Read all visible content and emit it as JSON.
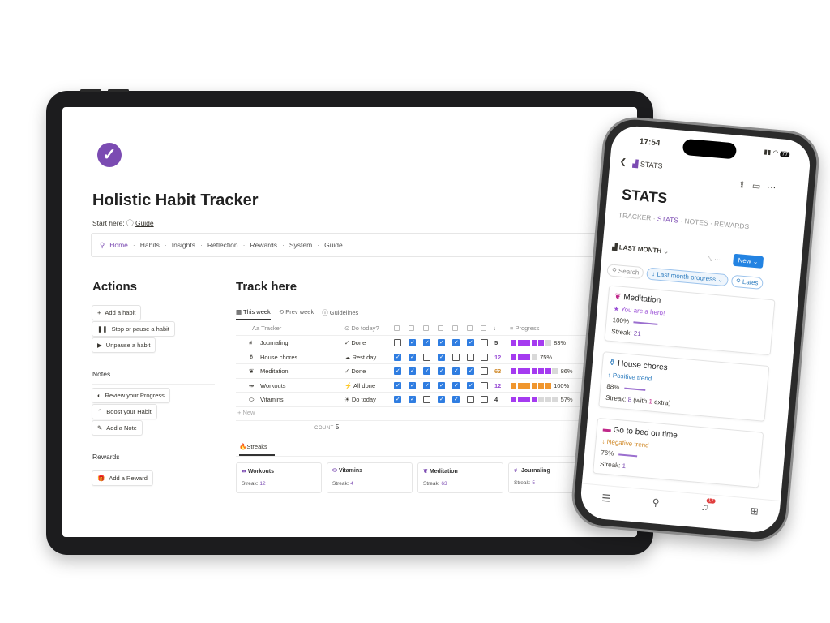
{
  "tablet": {
    "title": "Holistic Habit Tracker",
    "start_label": "Start here:",
    "start_link": "Guide",
    "nav": [
      "Home",
      "Habits",
      "Insights",
      "Reflection",
      "Rewards",
      "System",
      "Guide"
    ],
    "actions": {
      "heading": "Actions",
      "buttons": [
        "Add a habit",
        "Stop or pause a habit",
        "Unpause a habit"
      ]
    },
    "notes": {
      "heading": "Notes",
      "buttons": [
        "Review your Progress",
        "Boost your Habit",
        "Add a Note"
      ]
    },
    "rewards": {
      "heading": "Rewards",
      "buttons": [
        "Add a Reward"
      ]
    },
    "track": {
      "heading": "Track here",
      "tabs": [
        "This week",
        "Prev week",
        "Guidelines"
      ],
      "columns": {
        "tracker": "Tracker",
        "today": "Do today?",
        "progress": "Progress"
      },
      "rows": [
        {
          "name": "Journaling",
          "icon": "pen-lines-icon",
          "today": "Done",
          "today_icon": "✓",
          "checks": [
            0,
            1,
            1,
            1,
            1,
            1,
            0
          ],
          "streak": "5",
          "streak_color": "#333333",
          "filled": 5,
          "total": 6,
          "color": "#a53bf0",
          "pct": "83%"
        },
        {
          "name": "House chores",
          "icon": "broom-icon",
          "today": "Rest day",
          "today_icon": "☁",
          "checks": [
            1,
            1,
            0,
            1,
            0,
            0,
            0
          ],
          "streak": "12",
          "streak_color": "#9a4fd6",
          "filled": 3,
          "total": 4,
          "color": "#a53bf0",
          "pct": "75%"
        },
        {
          "name": "Meditation",
          "icon": "leaf-icon",
          "today": "Done",
          "today_icon": "✓",
          "checks": [
            1,
            1,
            1,
            1,
            1,
            1,
            0
          ],
          "streak": "63",
          "streak_color": "#d08a2a",
          "filled": 6,
          "total": 7,
          "color": "#a53bf0",
          "pct": "86%"
        },
        {
          "name": "Workouts",
          "icon": "dumbbell-icon",
          "today": "All done",
          "today_icon": "⚡",
          "checks": [
            1,
            1,
            1,
            1,
            1,
            1,
            0
          ],
          "streak": "12",
          "streak_color": "#9a4fd6",
          "filled": 6,
          "total": 6,
          "color": "#f0962e",
          "pct": "100%"
        },
        {
          "name": "Vitamins",
          "icon": "pill-icon",
          "today": "Do today",
          "today_icon": "☀",
          "checks": [
            1,
            1,
            0,
            1,
            1,
            0,
            0
          ],
          "streak": "4",
          "streak_color": "#333333",
          "filled": 4,
          "total": 7,
          "color": "#a53bf0",
          "pct": "57%"
        }
      ],
      "new_label": "New",
      "count_label": "COUNT",
      "count": "5"
    },
    "streaks": {
      "tab": "Streaks",
      "label": "Streak:",
      "cards": [
        {
          "name": "Workouts",
          "streak": "12",
          "icon": "dumbbell-icon"
        },
        {
          "name": "Vitamins",
          "streak": "4",
          "icon": "pill-icon"
        },
        {
          "name": "Meditation",
          "streak": "63",
          "icon": "leaf-icon"
        },
        {
          "name": "Journaling",
          "streak": "5",
          "icon": "pen-lines-icon"
        }
      ]
    }
  },
  "phone": {
    "time": "17:54",
    "battery": "77",
    "page": "STATS",
    "heading": "STATS",
    "tabs": [
      "TRACKER",
      "STATS",
      "NOTES",
      "REWARDS"
    ],
    "view": "LAST MONTH",
    "new_button": "New",
    "search": "Search",
    "filter": "Last month progress",
    "filter2": "Lates",
    "cards": [
      {
        "name": "Meditation",
        "status": "You are a hero!",
        "status_icon": "★",
        "status_color": "#9a4fd6",
        "pct": "100%",
        "progress": 100,
        "streak": "21"
      },
      {
        "name": "House chores",
        "status": "Positive trend",
        "status_icon": "↑",
        "status_color": "#2f7dbf",
        "pct": "88%",
        "progress": 88,
        "streak": "8",
        "extra_pre": "(with",
        "extra": "1",
        "extra_post": "extra)"
      },
      {
        "name": "Go to bed on time",
        "status": "Negative trend",
        "status_icon": "↓",
        "status_color": "#d08a2a",
        "pct": "76%",
        "progress": 76,
        "streak": "1"
      }
    ],
    "streak_label": "Streak:",
    "badge": "17"
  },
  "colors": {
    "accent": "#7b4bb2",
    "checkbox": "#2f7de1",
    "progress": "#a53bf0",
    "progress_full": "#f0962e",
    "new_button": "#2383e2"
  }
}
